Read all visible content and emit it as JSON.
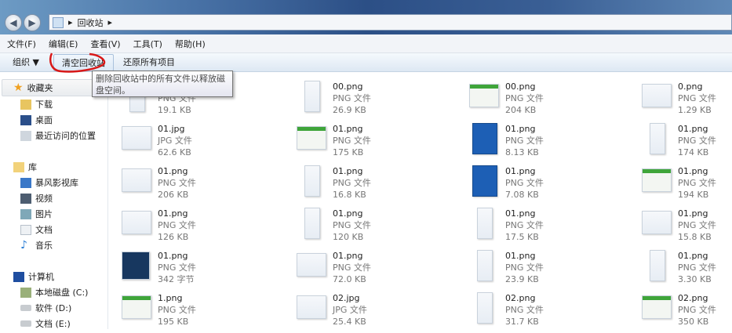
{
  "address": {
    "path": [
      "回收站"
    ]
  },
  "menu": [
    "文件(F)",
    "编辑(E)",
    "查看(V)",
    "工具(T)",
    "帮助(H)"
  ],
  "toolbar": {
    "organize": "组织 ▼",
    "empty": "清空回收站",
    "restore": "还原所有项目"
  },
  "tooltip": "删除回收站中的所有文件以释放磁盘空间。",
  "sidebar": {
    "favorites": {
      "label": "收藏夹",
      "items": [
        "下载",
        "桌面",
        "最近访问的位置"
      ]
    },
    "libraries": {
      "label": "库",
      "items": [
        "暴风影视库",
        "视频",
        "图片",
        "文档",
        "音乐"
      ]
    },
    "computer": {
      "label": "计算机",
      "items": [
        "本地磁盘 (C:)",
        "软件 (D:)",
        "文档 (E:)"
      ]
    }
  },
  "files": [
    {
      "name": "",
      "type": "PNG 文件",
      "size": "19.1 KB",
      "thumb": "tall"
    },
    {
      "name": "00.png",
      "type": "PNG 文件",
      "size": "26.9 KB",
      "thumb": "tall"
    },
    {
      "name": "00.png",
      "type": "PNG 文件",
      "size": "204 KB",
      "thumb": "green"
    },
    {
      "name": "0.png",
      "type": "PNG 文件",
      "size": "1.29 KB",
      "thumb": "flat"
    },
    {
      "name": "01.jpg",
      "type": "JPG 文件",
      "size": "62.6 KB",
      "thumb": "wide"
    },
    {
      "name": "01.png",
      "type": "PNG 文件",
      "size": "175 KB",
      "thumb": "green"
    },
    {
      "name": "01.png",
      "type": "PNG 文件",
      "size": "8.13 KB",
      "thumb": "blue"
    },
    {
      "name": "01.png",
      "type": "PNG 文件",
      "size": "174 KB",
      "thumb": "tall"
    },
    {
      "name": "01.png",
      "type": "PNG 文件",
      "size": "206 KB",
      "thumb": "wide"
    },
    {
      "name": "01.png",
      "type": "PNG 文件",
      "size": "16.8 KB",
      "thumb": "tall"
    },
    {
      "name": "01.png",
      "type": "PNG 文件",
      "size": "7.08 KB",
      "thumb": "blue"
    },
    {
      "name": "01.png",
      "type": "PNG 文件",
      "size": "194 KB",
      "thumb": "green"
    },
    {
      "name": "01.png",
      "type": "PNG 文件",
      "size": "126 KB",
      "thumb": "wide"
    },
    {
      "name": "01.png",
      "type": "PNG 文件",
      "size": "120 KB",
      "thumb": "tall"
    },
    {
      "name": "01.png",
      "type": "PNG 文件",
      "size": "17.5 KB",
      "thumb": "tall"
    },
    {
      "name": "01.png",
      "type": "PNG 文件",
      "size": "15.8 KB",
      "thumb": "wide"
    },
    {
      "name": "01.png",
      "type": "PNG 文件",
      "size": "342 字节",
      "thumb": "navy"
    },
    {
      "name": "01.png",
      "type": "PNG 文件",
      "size": "72.0 KB",
      "thumb": "wide"
    },
    {
      "name": "01.png",
      "type": "PNG 文件",
      "size": "23.9 KB",
      "thumb": "tall"
    },
    {
      "name": "01.png",
      "type": "PNG 文件",
      "size": "3.30 KB",
      "thumb": "tall"
    },
    {
      "name": "1.png",
      "type": "PNG 文件",
      "size": "195 KB",
      "thumb": "green"
    },
    {
      "name": "02.jpg",
      "type": "JPG 文件",
      "size": "25.4 KB",
      "thumb": "wide"
    },
    {
      "name": "02.png",
      "type": "PNG 文件",
      "size": "31.7 KB",
      "thumb": "tall"
    },
    {
      "name": "02.png",
      "type": "PNG 文件",
      "size": "350 KB",
      "thumb": "green"
    }
  ]
}
